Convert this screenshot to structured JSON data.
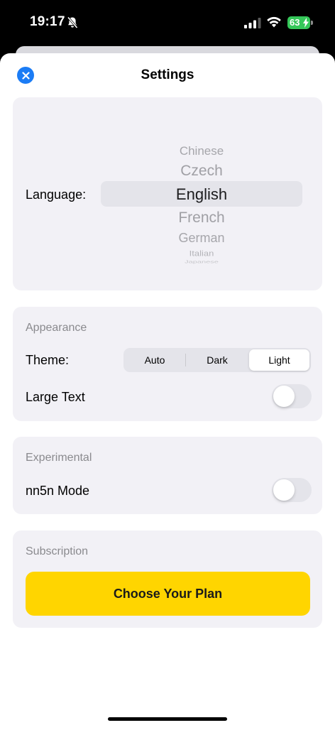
{
  "status_bar": {
    "time": "19:17",
    "battery": "63",
    "battery_color": "#35c759"
  },
  "header": {
    "title": "Settings",
    "close_icon": "close-icon",
    "accent": "#1b7cf5"
  },
  "language": {
    "label": "Language:",
    "options": [
      "Chinese",
      "Czech",
      "English",
      "French",
      "German",
      "Italian",
      "Japanese"
    ],
    "selected": "English"
  },
  "appearance": {
    "header": "Appearance",
    "theme_label": "Theme:",
    "theme_options": [
      "Auto",
      "Dark",
      "Light"
    ],
    "theme_selected": "Light",
    "large_text_label": "Large Text",
    "large_text_on": false
  },
  "experimental": {
    "header": "Experimental",
    "nn5n_label": "nn5n Mode",
    "nn5n_on": false
  },
  "subscription": {
    "header": "Subscription",
    "button_label": "Choose Your Plan",
    "button_color": "#ffd500"
  }
}
